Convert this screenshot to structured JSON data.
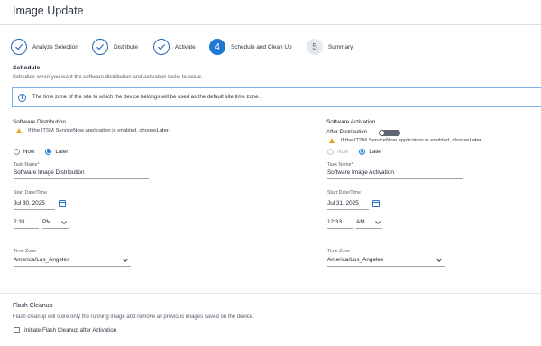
{
  "page": {
    "title": "Image Update"
  },
  "steps": [
    {
      "label": "Analyze Selection",
      "number": "",
      "state": "done"
    },
    {
      "label": "Distribute",
      "number": "",
      "state": "done"
    },
    {
      "label": "Activate",
      "number": "",
      "state": "done"
    },
    {
      "label": "Schedule and Clean Up",
      "number": "4",
      "state": "active"
    },
    {
      "label": "Summary",
      "number": "5",
      "state": "todo"
    }
  ],
  "schedule": {
    "heading": "Schedule",
    "description": "Schedule when you want the software distribution and activation tasks to occur.",
    "info_banner": "The time zone of the site to which the device belongs will be used as the default site time zone."
  },
  "distribution": {
    "title": "Software Distribution",
    "warning_prefix": "If the ITSM ServiceNow application is enabled, choose ",
    "warning_emph": "Later",
    "warning_suffix": ".",
    "radio_now": "Now",
    "radio_later": "Later",
    "selected": "Later",
    "task_name_label": "Task Name*",
    "task_name_value": "Software Image Distribution",
    "start_label": "Start Date/Time",
    "date": "Jul 30, 2025",
    "time": "2:33",
    "ampm": "PM",
    "timezone_label": "Time Zone",
    "timezone": "America/Los_Angeles"
  },
  "activation": {
    "title": "Software Activation",
    "after_distribution_label": "After Distribution",
    "after_distribution_on": false,
    "warning_prefix": "If the ITSM ServiceNow application is enabled, choose ",
    "warning_emph": "Later",
    "warning_suffix": ".",
    "radio_now": "Now",
    "radio_later": "Later",
    "selected": "Later",
    "task_name_label": "Task Name*",
    "task_name_value": "Software Image Activation",
    "start_label": "Start Date/Time",
    "date": "Jul 31, 2025",
    "time": "12:33",
    "ampm": "AM",
    "timezone_label": "Time Zone",
    "timezone": "America/Los_Angeles"
  },
  "flash_cleanup": {
    "heading": "Flash Cleanup",
    "description": "Flash cleanup will store only the running image and remove all previous images saved on the device.",
    "checkbox_label": "Initiate Flash Cleanup after Activation",
    "checked": false
  },
  "colors": {
    "accent": "#1f78d1",
    "warning": "#e8a317",
    "info_border": "#7fb0e6"
  }
}
